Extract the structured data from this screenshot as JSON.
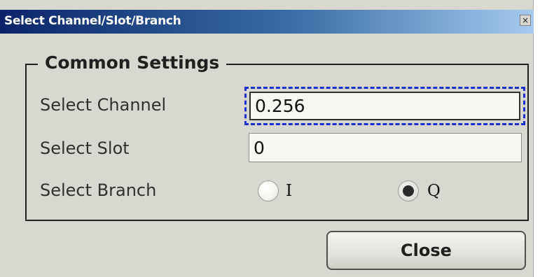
{
  "window": {
    "title": "Select Channel/Slot/Branch",
    "close_glyph": "×"
  },
  "group": {
    "title": "Common Settings"
  },
  "fields": {
    "channel_label": "Select Channel",
    "channel_value": "0.256",
    "slot_label": "Select Slot",
    "slot_value": "0",
    "branch_label": "Select Branch"
  },
  "branch": {
    "options": [
      {
        "label": "I",
        "checked": false
      },
      {
        "label": "Q",
        "checked": true
      }
    ]
  },
  "buttons": {
    "close_label": "Close"
  },
  "colors": {
    "title_bar_start": "#0a246a",
    "title_bar_end": "#a6caf0",
    "dialog_bg": "#d8d8d0",
    "focus_ring": "#1c2fd0"
  }
}
